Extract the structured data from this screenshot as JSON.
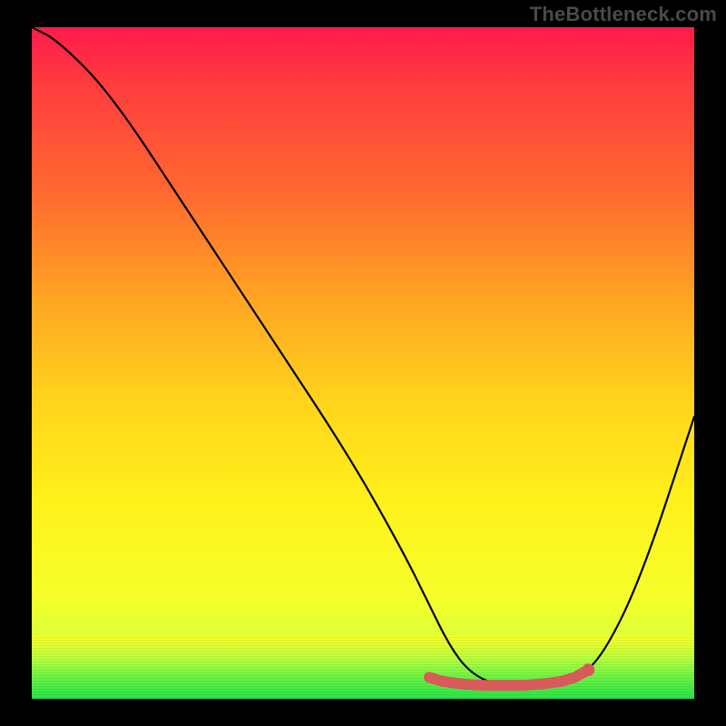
{
  "watermark": "TheBottleneck.com",
  "chart_data": {
    "type": "line",
    "title": "",
    "xlabel": "",
    "ylabel": "",
    "xlim": [
      0,
      100
    ],
    "ylim": [
      0,
      100
    ],
    "series": [
      {
        "name": "black-curve",
        "x": [
          0,
          4,
          12,
          24,
          36,
          48,
          56,
          60,
          63,
          66,
          70,
          74,
          78,
          82,
          86,
          92,
          100
        ],
        "y": [
          100,
          98,
          90,
          72,
          54,
          36,
          22,
          14,
          8,
          4,
          2,
          2,
          2.5,
          3,
          6,
          18,
          42
        ]
      },
      {
        "name": "red-marker-band",
        "x": [
          60,
          62,
          65,
          68,
          71,
          74,
          77,
          80,
          82,
          84
        ],
        "y": [
          3.2,
          2.6,
          2.2,
          2.0,
          2.0,
          2.0,
          2.2,
          2.6,
          3.2,
          4.3
        ]
      }
    ],
    "grid": false,
    "legend": false
  }
}
